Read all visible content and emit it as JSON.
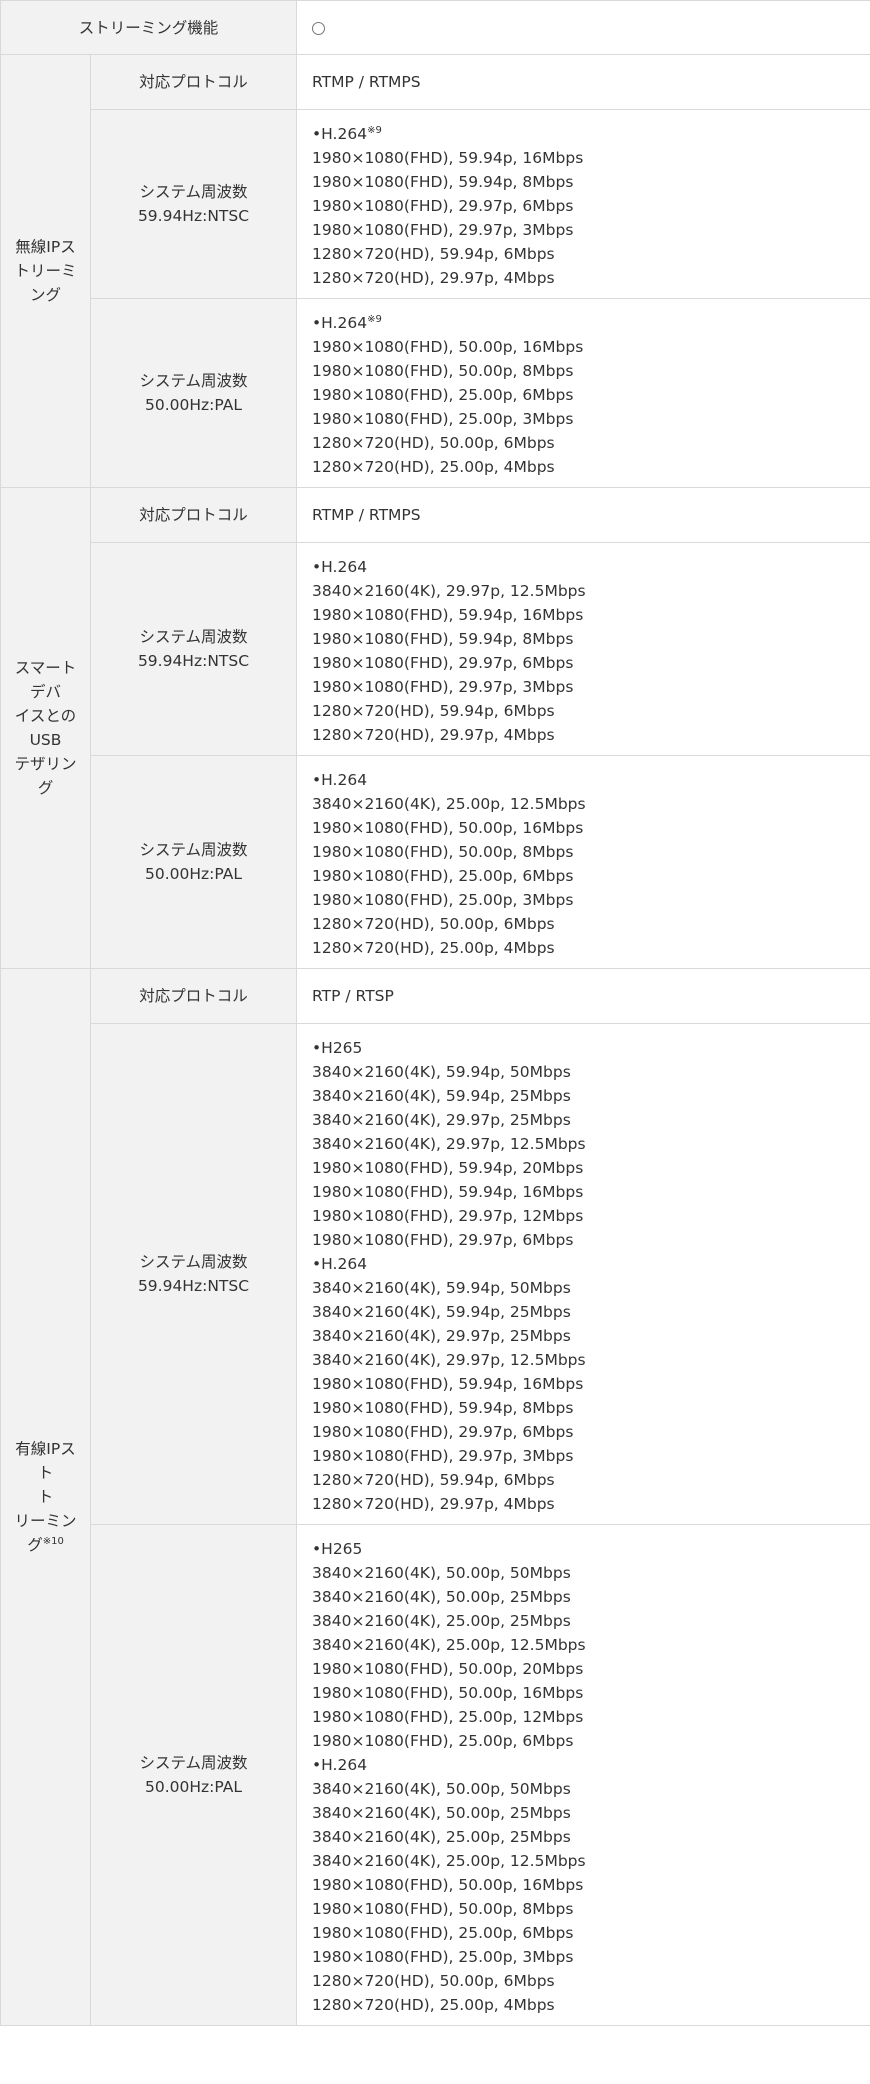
{
  "streaming_function": {
    "label": "ストリーミング機能",
    "value_icon": "circle-mark-icon"
  },
  "common": {
    "protocol_label": "対応プロトコル"
  },
  "sections": [
    {
      "title_lines": [
        "無線IPス",
        "トリーミ",
        "ング"
      ],
      "protocol": "RTMP / RTMPS",
      "ntsc": {
        "label_lines": [
          "システム周波数",
          "59.94Hz:NTSC"
        ],
        "values": [
          "•H.264",
          "1980×1080(FHD), 59.94p, 16Mbps",
          "1980×1080(FHD), 59.94p, 8Mbps",
          "1980×1080(FHD), 29.97p, 6Mbps",
          "1980×1080(FHD), 29.97p, 3Mbps",
          "1280×720(HD), 59.94p, 6Mbps",
          "1280×720(HD), 29.97p, 4Mbps"
        ],
        "first_note": "※9"
      },
      "pal": {
        "label_lines": [
          "システム周波数",
          "50.00Hz:PAL"
        ],
        "values": [
          "•H.264",
          "1980×1080(FHD), 50.00p, 16Mbps",
          "1980×1080(FHD), 50.00p, 8Mbps",
          "1980×1080(FHD), 25.00p, 6Mbps",
          "1980×1080(FHD), 25.00p, 3Mbps",
          "1280×720(HD), 50.00p, 6Mbps",
          "1280×720(HD), 25.00p, 4Mbps"
        ],
        "first_note": "※9"
      }
    },
    {
      "title_lines": [
        "スマート",
        "デバ",
        "イスとの",
        "USB",
        "テザリン",
        "グ"
      ],
      "protocol": "RTMP / RTMPS",
      "ntsc": {
        "label_lines": [
          "システム周波数",
          "59.94Hz:NTSC"
        ],
        "values": [
          "•H.264",
          "3840×2160(4K), 29.97p, 12.5Mbps",
          "1980×1080(FHD), 59.94p, 16Mbps",
          "1980×1080(FHD), 59.94p, 8Mbps",
          "1980×1080(FHD), 29.97p, 6Mbps",
          "1980×1080(FHD), 29.97p, 3Mbps",
          "1280×720(HD), 59.94p, 6Mbps",
          "1280×720(HD), 29.97p, 4Mbps"
        ]
      },
      "pal": {
        "label_lines": [
          "システム周波数",
          "50.00Hz:PAL"
        ],
        "values": [
          "•H.264",
          "3840×2160(4K), 25.00p, 12.5Mbps",
          "1980×1080(FHD), 50.00p, 16Mbps",
          "1980×1080(FHD), 50.00p, 8Mbps",
          "1980×1080(FHD), 25.00p, 6Mbps",
          "1980×1080(FHD), 25.00p, 3Mbps",
          "1280×720(HD), 50.00p, 6Mbps",
          "1280×720(HD), 25.00p, 4Mbps"
        ]
      }
    },
    {
      "title_lines": [
        "有線IPスト",
        "ト",
        "リーミン",
        "グ"
      ],
      "title_note": "※10",
      "protocol": "RTP / RTSP",
      "ntsc": {
        "label_lines": [
          "システム周波数",
          "59.94Hz:NTSC"
        ],
        "values": [
          "•H265",
          "3840×2160(4K), 59.94p, 50Mbps",
          "3840×2160(4K), 59.94p, 25Mbps",
          "3840×2160(4K), 29.97p, 25Mbps",
          "3840×2160(4K), 29.97p, 12.5Mbps",
          "1980×1080(FHD), 59.94p, 20Mbps",
          "1980×1080(FHD), 59.94p, 16Mbps",
          "1980×1080(FHD), 29.97p, 12Mbps",
          "1980×1080(FHD), 29.97p, 6Mbps",
          "•H.264",
          "3840×2160(4K), 59.94p, 50Mbps",
          "3840×2160(4K), 59.94p, 25Mbps",
          "3840×2160(4K), 29.97p, 25Mbps",
          "3840×2160(4K), 29.97p, 12.5Mbps",
          "1980×1080(FHD), 59.94p, 16Mbps",
          "1980×1080(FHD), 59.94p, 8Mbps",
          "1980×1080(FHD), 29.97p, 6Mbps",
          "1980×1080(FHD), 29.97p, 3Mbps",
          "1280×720(HD), 59.94p, 6Mbps",
          "1280×720(HD), 29.97p, 4Mbps"
        ]
      },
      "pal": {
        "label_lines": [
          "システム周波数",
          "50.00Hz:PAL"
        ],
        "values": [
          "•H265",
          "3840×2160(4K), 50.00p, 50Mbps",
          "3840×2160(4K), 50.00p, 25Mbps",
          "3840×2160(4K), 25.00p, 25Mbps",
          "3840×2160(4K), 25.00p, 12.5Mbps",
          "1980×1080(FHD), 50.00p, 20Mbps",
          "1980×1080(FHD), 50.00p, 16Mbps",
          "1980×1080(FHD), 25.00p, 12Mbps",
          "1980×1080(FHD), 25.00p, 6Mbps",
          "•H.264",
          "3840×2160(4K), 50.00p, 50Mbps",
          "3840×2160(4K), 50.00p, 25Mbps",
          "3840×2160(4K), 25.00p, 25Mbps",
          "3840×2160(4K), 25.00p, 12.5Mbps",
          "1980×1080(FHD), 50.00p, 16Mbps",
          "1980×1080(FHD), 50.00p, 8Mbps",
          "1980×1080(FHD), 25.00p, 6Mbps",
          "1980×1080(FHD), 25.00p, 3Mbps",
          "1280×720(HD), 50.00p, 6Mbps",
          "1280×720(HD), 25.00p, 4Mbps"
        ]
      }
    }
  ]
}
